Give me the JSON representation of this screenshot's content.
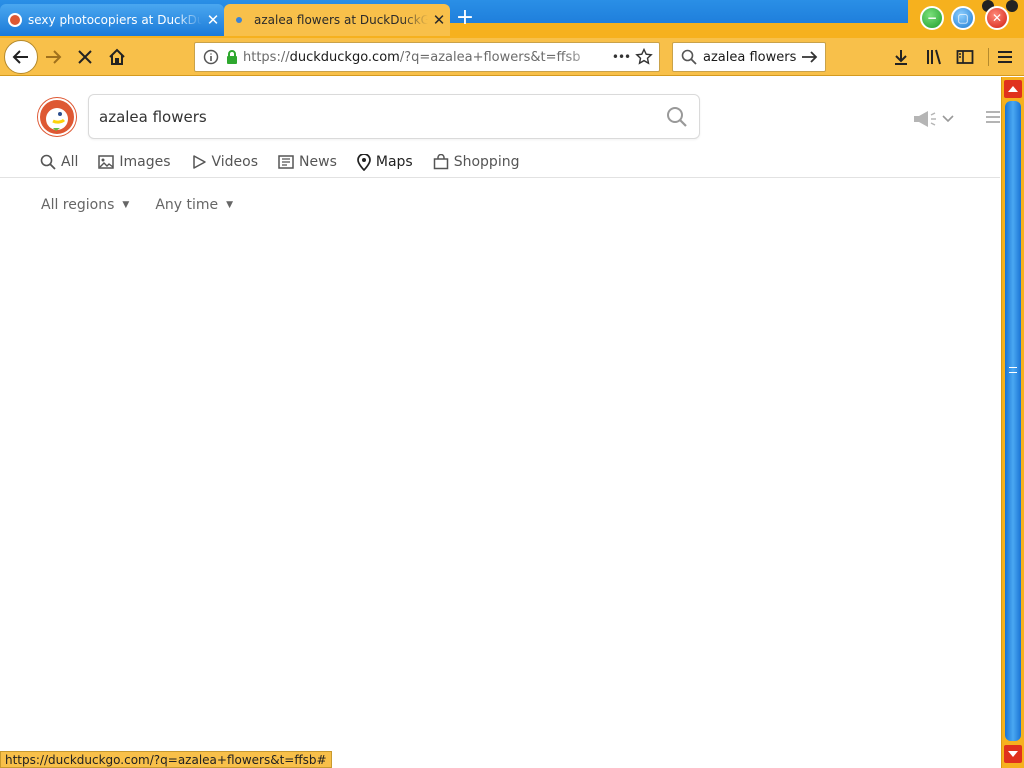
{
  "browser": {
    "tabs": [
      {
        "title": "sexy photocopiers at DuckDuckGo",
        "active": false
      },
      {
        "title": "azalea flowers at DuckDuckGo",
        "active": true
      }
    ],
    "new_tab_symbol": "+",
    "window_controls": [
      "minimize",
      "maximize",
      "close"
    ],
    "url": {
      "scheme": "https://",
      "domain": "duckduckgo.com",
      "path": "/?q=azalea+flowers&t=ffsb"
    },
    "url_actions_symbol": "•••",
    "search_box_value": "azalea flowers"
  },
  "page": {
    "search": {
      "value": "azalea flowers"
    },
    "nav_tabs": [
      {
        "label": "All",
        "icon": "search-icon"
      },
      {
        "label": "Images",
        "icon": "image-icon"
      },
      {
        "label": "Videos",
        "icon": "play-icon"
      },
      {
        "label": "News",
        "icon": "newspaper-icon"
      },
      {
        "label": "Maps",
        "icon": "map-pin-icon",
        "active": true
      },
      {
        "label": "Shopping",
        "icon": "shopping-bag-icon"
      }
    ],
    "filters": {
      "region": "All regions",
      "time": "Any time"
    }
  },
  "status_bar": {
    "text": "https://duckduckgo.com/?q=azalea+flowers&t=ffsb#"
  },
  "colors": {
    "accent_yellow": "#f8c04a",
    "tab_blue": "#1f7fdc",
    "ddg_orange": "#de5833",
    "scroll_red": "#e0311d"
  }
}
